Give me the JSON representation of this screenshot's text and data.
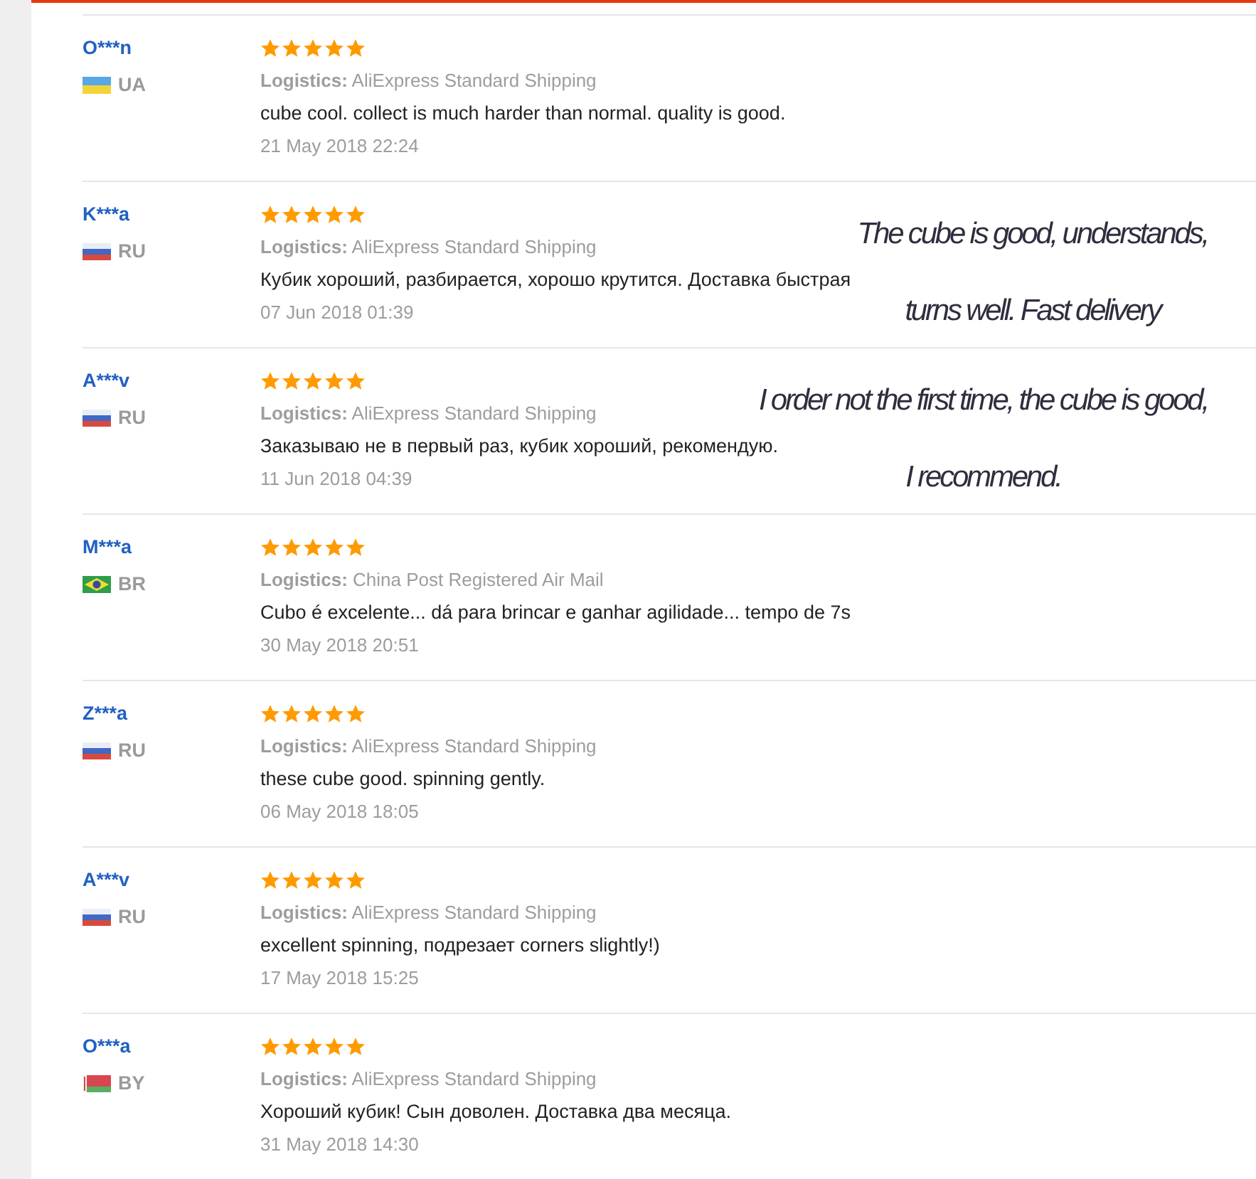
{
  "reviews": [
    {
      "name": "O***n",
      "flag": {
        "kind": "ua"
      },
      "country": "UA",
      "stars": 5,
      "logistics": "**Logistics:** AliExpress Standard Shipping",
      "comment": "cube cool. collect is much harder than normal. quality is good.",
      "date": "21 May 2018 22:24"
    },
    {
      "name": "K***a",
      "flag": {
        "kind": "ru"
      },
      "country": "RU",
      "stars": 5,
      "logistics": "**Logistics:** AliExpress Standard Shipping",
      "comment": "Кубик хороший, разбирается, хорошо крутится. Доставка быстрая",
      "date": "07 Jun 2018 01:39",
      "translation": [
        "The cube is good, understands,",
        "turns well. Fast delivery"
      ]
    },
    {
      "name": "A***v",
      "flag": {
        "kind": "ru"
      },
      "country": "RU",
      "stars": 5,
      "logistics": "**Logistics:** AliExpress Standard Shipping",
      "comment": "Заказываю не в первый раз, кубик хороший, рекомендую.",
      "date": "11 Jun 2018 04:39",
      "translation": [
        "I order not the first time, the cube is good,",
        "I recommend."
      ]
    },
    {
      "name": "M***a",
      "flag": {
        "kind": "br"
      },
      "country": "BR",
      "stars": 5,
      "logistics": "**Logistics:** China Post Registered Air Mail",
      "comment": "Cubo é excelente... dá para brincar e ganhar agilidade... tempo de 7s",
      "date": "30 May 2018 20:51"
    },
    {
      "name": "Z***a",
      "flag": {
        "kind": "ru"
      },
      "country": "RU",
      "stars": 5,
      "logistics": "**Logistics:** AliExpress Standard Shipping",
      "comment": "these cube good. spinning gently.",
      "date": "06 May 2018 18:05"
    },
    {
      "name": "A***v",
      "flag": {
        "kind": "ru"
      },
      "country": "RU",
      "stars": 5,
      "logistics": "**Logistics:** AliExpress Standard Shipping",
      "comment": "excellent spinning, подрезает corners slightly!)",
      "date": "17 May 2018 15:25"
    },
    {
      "name": "O***a",
      "flag": {
        "kind": "by"
      },
      "country": "BY",
      "stars": 5,
      "logistics": "**Logistics:** AliExpress Standard Shipping",
      "comment": "Хороший кубик! Сын доволен. Доставка два месяца.",
      "date": "31 May 2018 14:30"
    }
  ]
}
